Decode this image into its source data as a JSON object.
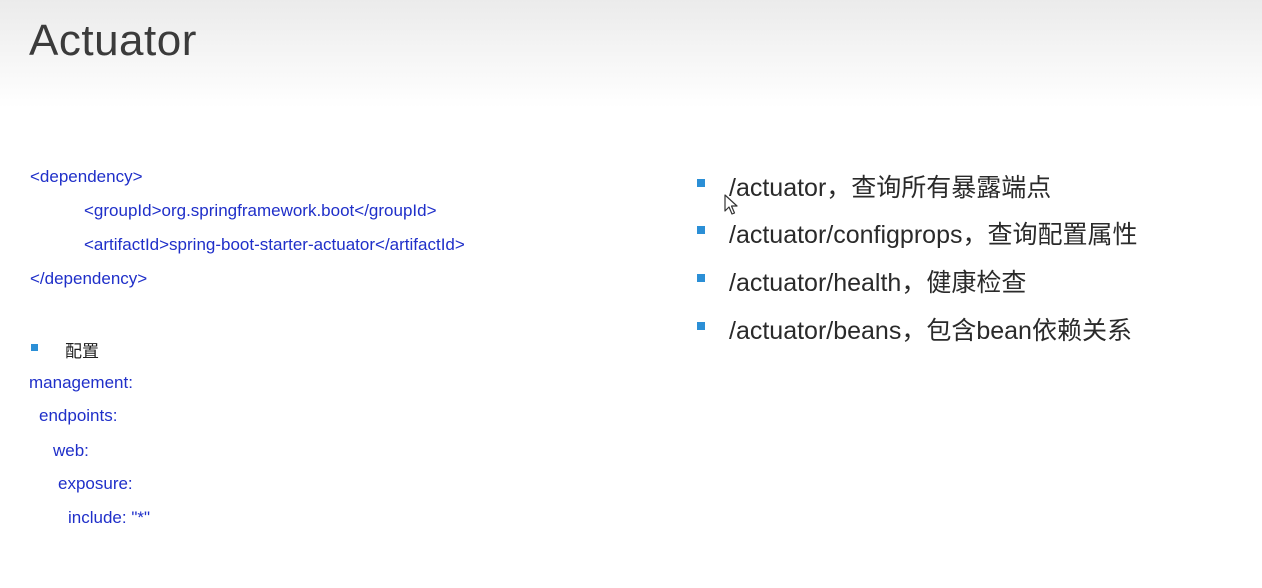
{
  "slide": {
    "title": "Actuator"
  },
  "dependency": {
    "lines": [
      "<dependency>",
      "<groupId>org.springframework.boot</groupId>",
      "<artifactId>spring-boot-starter-actuator</artifactId>",
      "</dependency>"
    ]
  },
  "config": {
    "label": "配置",
    "lines": [
      "management:",
      "endpoints:",
      "web:",
      "exposure:",
      "include: \"*\""
    ]
  },
  "endpoints": {
    "items": [
      "/actuator，查询所有暴露端点",
      "/actuator/configprops，查询配置属性",
      "/actuator/health，健康检查",
      "/actuator/beans，包含bean依赖关系"
    ]
  },
  "colors": {
    "code": "#1f2fc9",
    "bullet": "#2b8fd6",
    "title": "#3b3b3b"
  },
  "icons": [
    "mouse-cursor-icon"
  ]
}
